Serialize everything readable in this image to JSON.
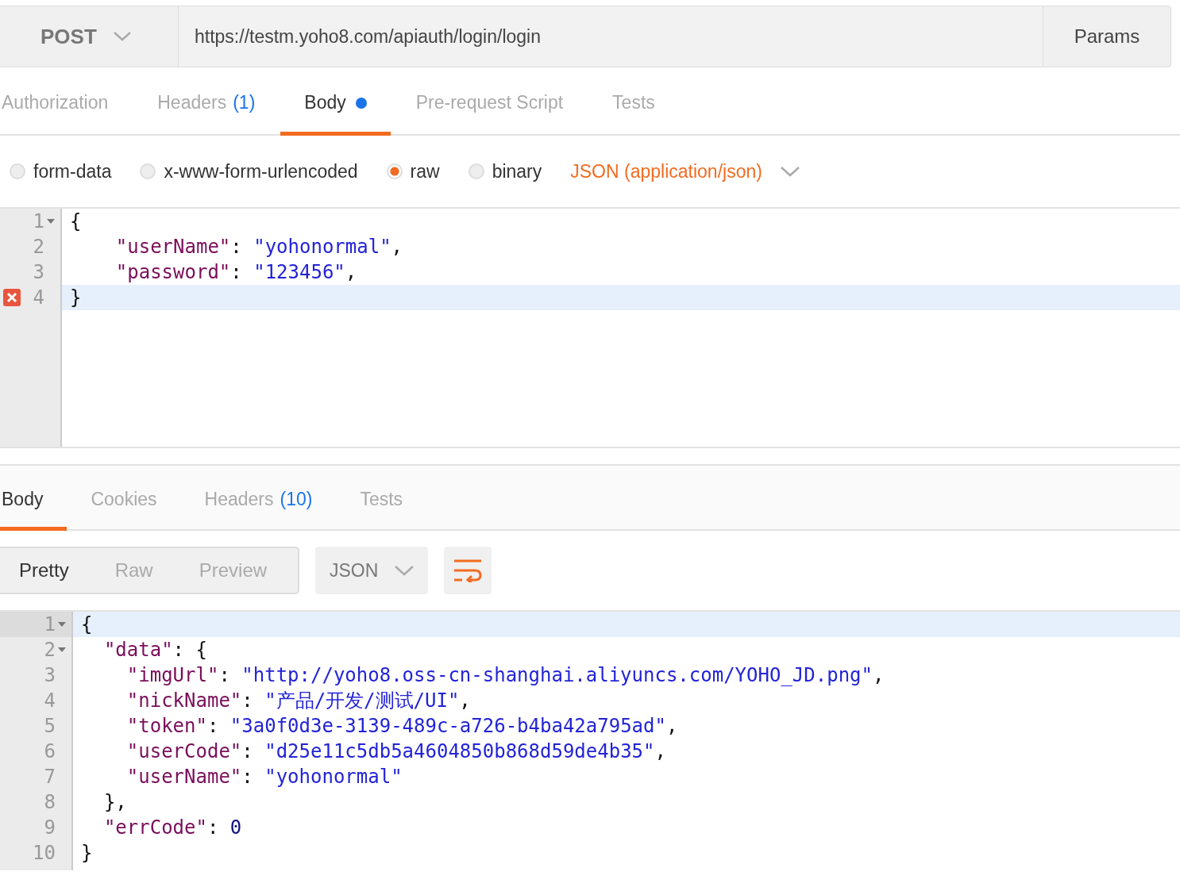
{
  "request": {
    "method": "POST",
    "url": "https://testm.yoho8.com/apiauth/login/login",
    "params_button": "Params"
  },
  "request_tabs": [
    {
      "label": "Authorization",
      "selected": false
    },
    {
      "label": "Headers",
      "count": "(1)",
      "selected": false
    },
    {
      "label": "Body",
      "modified": true,
      "selected": true
    },
    {
      "label": "Pre-request Script",
      "selected": false
    },
    {
      "label": "Tests",
      "selected": false
    }
  ],
  "body_modes": [
    {
      "label": "form-data",
      "selected": false
    },
    {
      "label": "x-www-form-urlencoded",
      "selected": false
    },
    {
      "label": "raw",
      "selected": true
    },
    {
      "label": "binary",
      "selected": false
    }
  ],
  "content_type": "JSON (application/json)",
  "request_editor": [
    {
      "number": "1",
      "foldable": true,
      "error": false,
      "active": false,
      "tokens": [
        {
          "kind": "punct",
          "text": "{"
        }
      ]
    },
    {
      "number": "2",
      "foldable": false,
      "error": false,
      "active": false,
      "tokens": [
        {
          "kind": "key",
          "text": "    \"userName\""
        },
        {
          "kind": "punct",
          "text": ": "
        },
        {
          "kind": "string",
          "text": "\"yohonormal\""
        },
        {
          "kind": "punct",
          "text": ","
        }
      ]
    },
    {
      "number": "3",
      "foldable": false,
      "error": false,
      "active": false,
      "tokens": [
        {
          "kind": "key",
          "text": "    \"password\""
        },
        {
          "kind": "punct",
          "text": ": "
        },
        {
          "kind": "string",
          "text": "\"123456\""
        },
        {
          "kind": "punct",
          "text": ","
        }
      ]
    },
    {
      "number": "4",
      "foldable": false,
      "error": true,
      "active": true,
      "tokens": [
        {
          "kind": "punct",
          "text": "}"
        }
      ]
    }
  ],
  "response_tabs": [
    {
      "label": "Body",
      "selected": true
    },
    {
      "label": "Cookies",
      "selected": false
    },
    {
      "label": "Headers",
      "count": "(10)",
      "selected": false
    },
    {
      "label": "Tests",
      "selected": false
    }
  ],
  "view_modes": [
    {
      "label": "Pretty",
      "selected": true
    },
    {
      "label": "Raw",
      "selected": false
    },
    {
      "label": "Preview",
      "selected": false
    }
  ],
  "format": "JSON",
  "response_editor": [
    {
      "number": "1",
      "foldable": true,
      "active": true,
      "tokens": [
        {
          "kind": "punct",
          "text": "{"
        }
      ]
    },
    {
      "number": "2",
      "foldable": true,
      "active": false,
      "tokens": [
        {
          "kind": "key",
          "text": "  \"data\""
        },
        {
          "kind": "punct",
          "text": ": {"
        }
      ]
    },
    {
      "number": "3",
      "foldable": false,
      "active": false,
      "tokens": [
        {
          "kind": "key",
          "text": "    \"imgUrl\""
        },
        {
          "kind": "punct",
          "text": ": "
        },
        {
          "kind": "string",
          "text": "\"http://yoho8.oss-cn-shanghai.aliyuncs.com/YOHO_JD.png\""
        },
        {
          "kind": "punct",
          "text": ","
        }
      ]
    },
    {
      "number": "4",
      "foldable": false,
      "active": false,
      "tokens": [
        {
          "kind": "key",
          "text": "    \"nickName\""
        },
        {
          "kind": "punct",
          "text": ": "
        },
        {
          "kind": "string",
          "text": "\"产品/开发/测试/UI\""
        },
        {
          "kind": "punct",
          "text": ","
        }
      ]
    },
    {
      "number": "5",
      "foldable": false,
      "active": false,
      "tokens": [
        {
          "kind": "key",
          "text": "    \"token\""
        },
        {
          "kind": "punct",
          "text": ": "
        },
        {
          "kind": "string",
          "text": "\"3a0f0d3e-3139-489c-a726-b4ba42a795ad\""
        },
        {
          "kind": "punct",
          "text": ","
        }
      ]
    },
    {
      "number": "6",
      "foldable": false,
      "active": false,
      "tokens": [
        {
          "kind": "key",
          "text": "    \"userCode\""
        },
        {
          "kind": "punct",
          "text": ": "
        },
        {
          "kind": "string",
          "text": "\"d25e11c5db5a4604850b868d59de4b35\""
        },
        {
          "kind": "punct",
          "text": ","
        }
      ]
    },
    {
      "number": "7",
      "foldable": false,
      "active": false,
      "tokens": [
        {
          "kind": "key",
          "text": "    \"userName\""
        },
        {
          "kind": "punct",
          "text": ": "
        },
        {
          "kind": "string",
          "text": "\"yohonormal\""
        }
      ]
    },
    {
      "number": "8",
      "foldable": false,
      "active": false,
      "tokens": [
        {
          "kind": "punct",
          "text": "  },"
        }
      ]
    },
    {
      "number": "9",
      "foldable": false,
      "active": false,
      "tokens": [
        {
          "kind": "key",
          "text": "  \"errCode\""
        },
        {
          "kind": "punct",
          "text": ": "
        },
        {
          "kind": "number",
          "text": "0"
        }
      ]
    },
    {
      "number": "10",
      "foldable": false,
      "active": false,
      "tokens": [
        {
          "kind": "punct",
          "text": "}"
        }
      ]
    }
  ]
}
